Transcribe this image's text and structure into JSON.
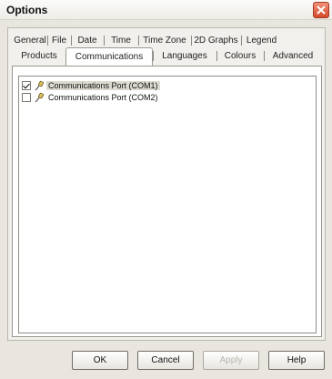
{
  "window": {
    "title": "Options",
    "close_icon": "close-icon"
  },
  "tabs": {
    "row1": [
      "General",
      "File",
      "Date",
      "Time",
      "Time Zone",
      "2D Graphs",
      "Legend"
    ],
    "row2": [
      "Products",
      "Communications",
      "Languages",
      "Colours",
      "Advanced"
    ],
    "active": "Communications"
  },
  "ports": [
    {
      "label": "Communications Port (COM1)",
      "checked": true,
      "selected": true,
      "icon": "plug-icon"
    },
    {
      "label": "Communications Port (COM2)",
      "checked": false,
      "selected": false,
      "icon": "plug-icon"
    }
  ],
  "buttons": {
    "ok": "OK",
    "cancel": "Cancel",
    "apply": "Apply",
    "help": "Help"
  },
  "colors": {
    "close_button": "#d44a2b",
    "dialog_bg": "#e8e6df",
    "panel_bg": "#ffffff"
  }
}
